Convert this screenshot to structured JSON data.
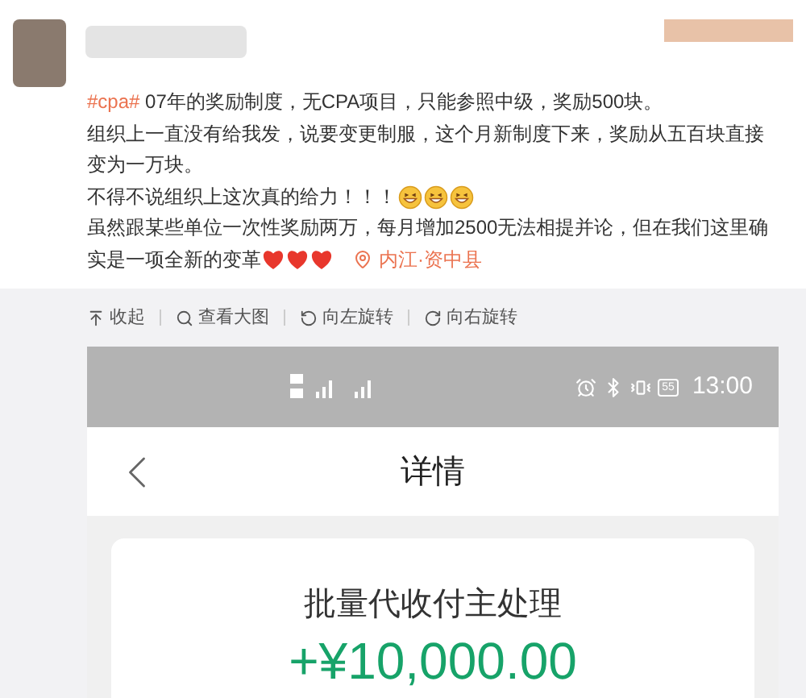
{
  "post": {
    "hashtag": "#cpa#",
    "lines": [
      "07年的奖励制度，无CPA项目，只能参照中级，奖励500块。",
      "组织上一直没有给我发，说要变更制服，这个月新制度下来，奖励从五百块直接",
      "变为一万块。",
      "不得不说组织上这次真的给力！！！",
      "虽然跟某些单位一次性奖励两万，每月增加2500无法相提并论，但在我们这里确",
      "实是一项全新的变革"
    ],
    "location": "内江·资中县"
  },
  "toolbar": [
    {
      "kind": "collapse",
      "label": "收起"
    },
    {
      "kind": "zoom",
      "label": "查看大图"
    },
    {
      "kind": "rotate-left",
      "label": "向左旋转"
    },
    {
      "kind": "rotate-right",
      "label": "向右旋转"
    }
  ],
  "phone": {
    "status_bar": {
      "battery": "55",
      "time": "13:00"
    },
    "header": {
      "title": "详情"
    },
    "card": {
      "title": "批量代收付主处理",
      "amount": "+¥10,000.00"
    }
  }
}
